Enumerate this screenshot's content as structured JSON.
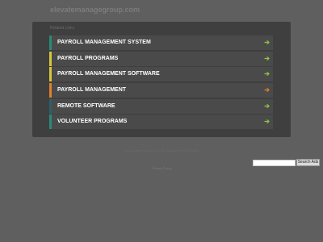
{
  "site": {
    "title": "elevatemanagegroup.com"
  },
  "panel": {
    "related_label": "Related Links",
    "links": [
      {
        "label": "PAYROLL MANAGEMENT SYSTEM",
        "accent": "#2a8a7a",
        "arrow_color": "#8dc63f",
        "arrow_icon": "arrow-right-icon"
      },
      {
        "label": "PAYROLL PROGRAMS",
        "accent": "#d7c63a",
        "arrow_color": "#8dc63f",
        "arrow_icon": "arrow-right-icon"
      },
      {
        "label": "PAYROLL MANAGEMENT SOFTWARE",
        "accent": "#d7c63a",
        "arrow_color": "#8dc63f",
        "arrow_icon": "arrow-right-icon"
      },
      {
        "label": "PAYROLL MANAGEMENT",
        "accent": "#e0802a",
        "arrow_color": "#e0802a",
        "arrow_icon": "arrow-right-icon"
      },
      {
        "label": "REMOTE SOFTWARE",
        "accent": "#2e5f6a",
        "arrow_color": "#8dc63f",
        "arrow_icon": "arrow-right-icon"
      },
      {
        "label": "VOLUNTEER PROGRAMS",
        "accent": "#2a8a7a",
        "arrow_color": "#8dc63f",
        "arrow_icon": "arrow-right-icon"
      }
    ]
  },
  "footer": {
    "disclaimer": "This domain may be for sale. Backorder this Domain",
    "privacy": "Privacy Policy"
  },
  "search": {
    "placeholder": "",
    "button_label": "Search Ads"
  },
  "colors": {
    "background": "#5f5f5f",
    "panel": "#3f3f3f",
    "row": "#4a4a4a"
  }
}
